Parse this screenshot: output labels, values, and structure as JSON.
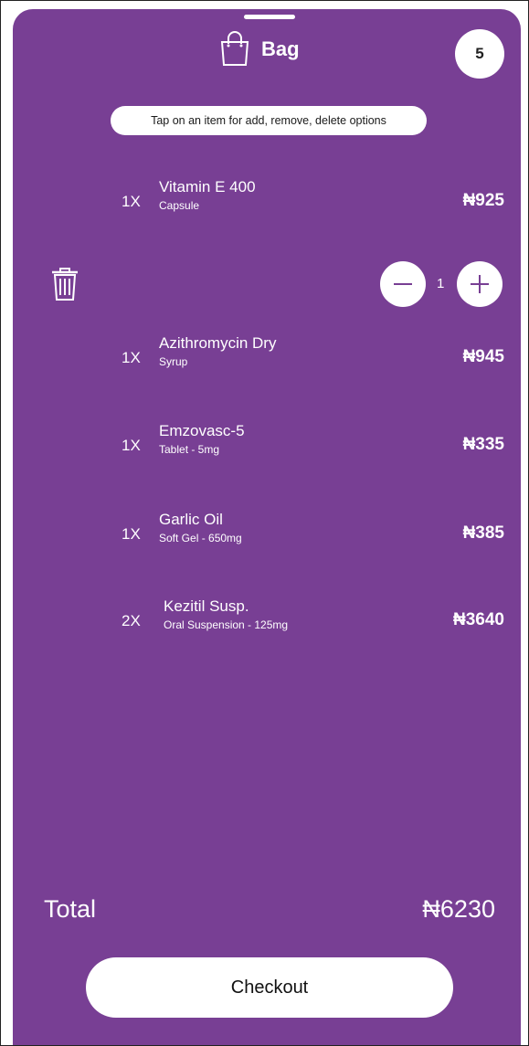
{
  "header": {
    "title": "Bag",
    "item_count": "5",
    "bag_icon": "shopping-bag-icon"
  },
  "hint": "Tap on an item for add, remove, delete options",
  "items": [
    {
      "qty": "1X",
      "name": "Vitamin E 400",
      "form": "Capsule",
      "price": "₦925"
    },
    {
      "qty": "1X",
      "name": "Azithromycin Dry",
      "form": "Syrup",
      "price": "₦945"
    },
    {
      "qty": "1X",
      "name": "Emzovasc-5",
      "form": "Tablet - 5mg",
      "price": "₦335"
    },
    {
      "qty": "1X",
      "name": "Garlic Oil",
      "form": "Soft Gel - 650mg",
      "price": "₦385"
    },
    {
      "qty": "2X",
      "name": "Kezitil Susp.",
      "form": "Oral Suspension - 125mg",
      "price": "₦3640"
    }
  ],
  "controls": {
    "stepper_value": "1",
    "delete_icon": "trash-icon",
    "minus_icon": "minus-icon",
    "plus_icon": "plus-icon"
  },
  "total": {
    "label": "Total",
    "value": "₦6230"
  },
  "checkout_label": "Checkout",
  "colors": {
    "background": "#783f94",
    "surface": "#ffffff"
  }
}
